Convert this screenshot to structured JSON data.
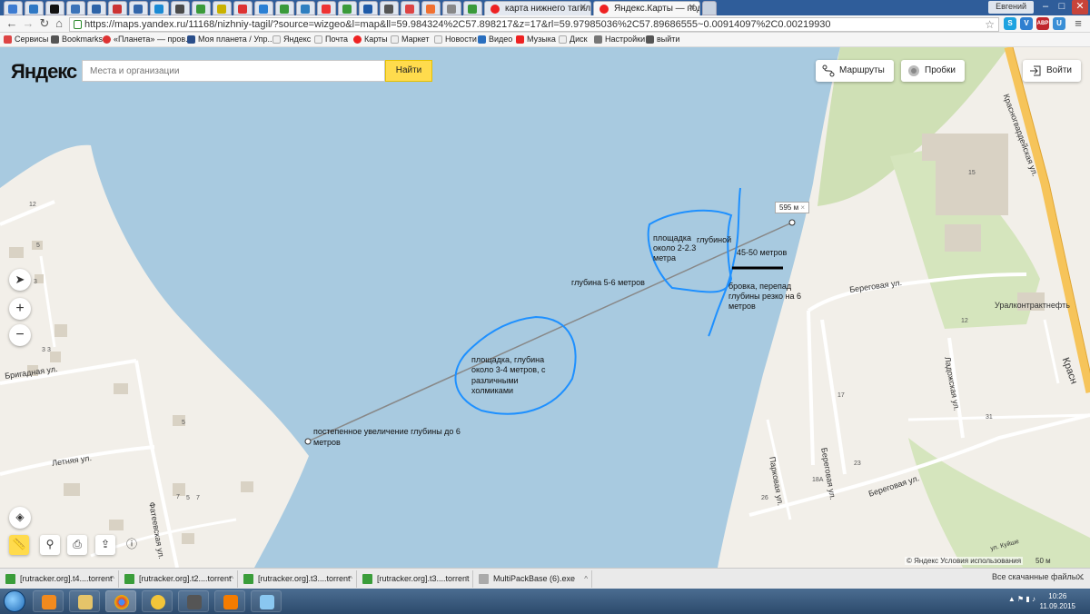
{
  "browser": {
    "tabs": [
      {
        "title": "карта нижнего тагила —"
      },
      {
        "title": "Яндекс.Карты — подроб"
      }
    ],
    "user": "Евгений",
    "window_controls": {
      "minimize": "–",
      "maximize": "□",
      "close": "✕"
    },
    "url": "https://maps.yandex.ru/11168/nizhniy-tagil/?source=wizgeo&l=map&ll=59.984324%2C57.898217&z=17&rl=59.97985036%2C57.89686555~0.00914097%2C0.00219930",
    "extensions": [
      "S",
      "V",
      "ABP",
      "U"
    ],
    "bookmarks": [
      "Сервисы",
      "Bookmarks",
      "«Планета» — пров...",
      "Моя планета / Упр...",
      "Яндекс",
      "Почта",
      "Карты",
      "Маркет",
      "Новости",
      "Видео",
      "Музыка",
      "Диск",
      "Настройки",
      "выйти"
    ]
  },
  "yandex": {
    "logo_main": "Яндекс",
    "search_placeholder": "Места и организации",
    "search_button": "Найти",
    "routes_button": "Маршруты",
    "traffic_button": "Пробки",
    "login_button": "Войти"
  },
  "map": {
    "distance_badge": "595 м",
    "streets": [
      "Красногвардейская ул.",
      "Бригадная ул.",
      "Летняя ул.",
      "Фатеевская ул.",
      "Береговая ул.",
      "Ладожская ул.",
      "Парковая ул.",
      "Береговая ул.",
      "Береговая ул.",
      "Красн",
      "ул. Куйше"
    ],
    "poi": "Уралконтрактнефть",
    "house_numbers": [
      "15",
      "12",
      "31",
      "17",
      "23",
      "18А",
      "26",
      "12",
      "3",
      "5",
      "3",
      "5",
      "7",
      "5",
      "7",
      "3"
    ],
    "annotations": {
      "depth_main": "глубина 5-6 метров",
      "zone_top": [
        "площадка",
        "глубиной",
        "около 2-2.3",
        "метра"
      ],
      "distance_note": "45-50 метров",
      "edge_note": [
        "бровка, перепад",
        "глубины резко на 6",
        "метров"
      ],
      "zone_bottom": [
        "площадка, глубина",
        "около 3-4 метров, с",
        "различными",
        "холмиками"
      ],
      "gradual": [
        "постепенное увеличение глубины до 6",
        "метров"
      ]
    },
    "copyright": "© Яндекс Условия использования",
    "scale": "50 м"
  },
  "downloads": {
    "items": [
      "[rutracker.org].t4....torrent",
      "[rutracker.org].t2....torrent",
      "[rutracker.org].t3....torrent",
      "[rutracker.org].t3....torrent",
      "MultiPackBase (6).exe"
    ],
    "all_label": "Все скачанные файлы...",
    "close": "✕"
  },
  "taskbar": {
    "time": "10:26",
    "date": "11.09.2015"
  },
  "colors": {
    "water": "#a8cae0",
    "land": "#f2efe9",
    "park": "#cfe0b5",
    "road_main": "#f6c45a",
    "annotation_blue": "#1e90ff",
    "search_button": "#ffdb4d"
  }
}
